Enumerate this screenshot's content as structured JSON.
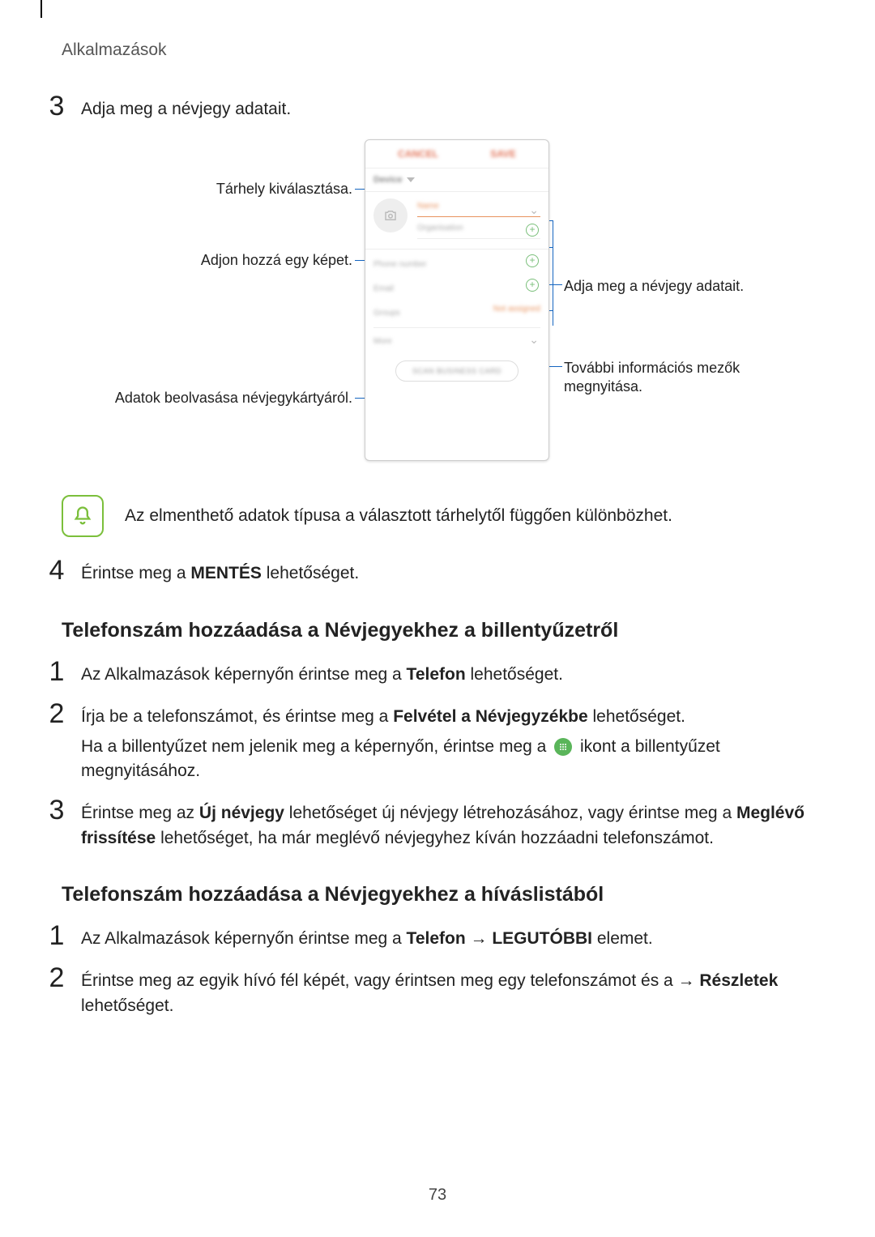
{
  "header": {
    "crumb": "Alkalmazások"
  },
  "step3": {
    "num": "3",
    "text": "Adja meg a névjegy adatait."
  },
  "diagram": {
    "callouts": {
      "storage": "Tárhely kiválasztása.",
      "addImage": "Adjon hozzá egy képet.",
      "scanCard": "Adatok beolvasása névjegykártyáról.",
      "enterData": "Adja meg a névjegy adatait.",
      "moreFields": "További információs mezők megnyitása."
    },
    "phone": {
      "cancel": "CANCEL",
      "save": "SAVE",
      "device": "Device",
      "name": "Name",
      "org": "Organisation",
      "phone": "Phone number",
      "email": "Email",
      "groups": "Groups",
      "notassigned": "Not assigned",
      "more": "More",
      "scan": "SCAN BUSINESS CARD"
    }
  },
  "note": {
    "text": "Az elmenthető adatok típusa a választott tárhelytől függően különbözhet."
  },
  "step4": {
    "num": "4",
    "pre": "Érintse meg a ",
    "bold": "MENTÉS",
    "post": " lehetőséget."
  },
  "sectionA": {
    "title": "Telefonszám hozzáadása a Névjegyekhez a billentyűzetről"
  },
  "stepA1": {
    "num": "1",
    "pre": "Az Alkalmazások képernyőn érintse meg a ",
    "bold": "Telefon",
    "post": " lehetőséget."
  },
  "stepA2": {
    "num": "2",
    "pre": "Írja be a telefonszámot, és érintse meg a ",
    "bold": "Felvétel a Névjegyzékbe",
    "post": " lehetőséget.",
    "sub_pre": "Ha a billentyűzet nem jelenik meg a képernyőn, érintse meg a ",
    "sub_post": " ikont a billentyűzet megnyitásához."
  },
  "stepA3": {
    "num": "3",
    "pre": "Érintse meg az ",
    "b1": "Új névjegy",
    "mid": " lehetőséget új névjegy létrehozásához, vagy érintse meg a ",
    "b2": "Meglévő frissítése",
    "post": " lehetőséget, ha már meglévő névjegyhez kíván hozzáadni telefonszámot."
  },
  "sectionB": {
    "title": "Telefonszám hozzáadása a Névjegyekhez a híváslistából"
  },
  "stepB1": {
    "num": "1",
    "pre": "Az Alkalmazások képernyőn érintse meg a ",
    "b1": "Telefon",
    "arrow": " → ",
    "b2": "LEGUTÓBBI",
    "post": " elemet."
  },
  "stepB2": {
    "num": "2",
    "pre": "Érintse meg az egyik hívó fél képét, vagy érintsen meg egy telefonszámot és a → ",
    "b1": "Részletek",
    "post": " lehetőséget."
  },
  "pagenum": "73"
}
